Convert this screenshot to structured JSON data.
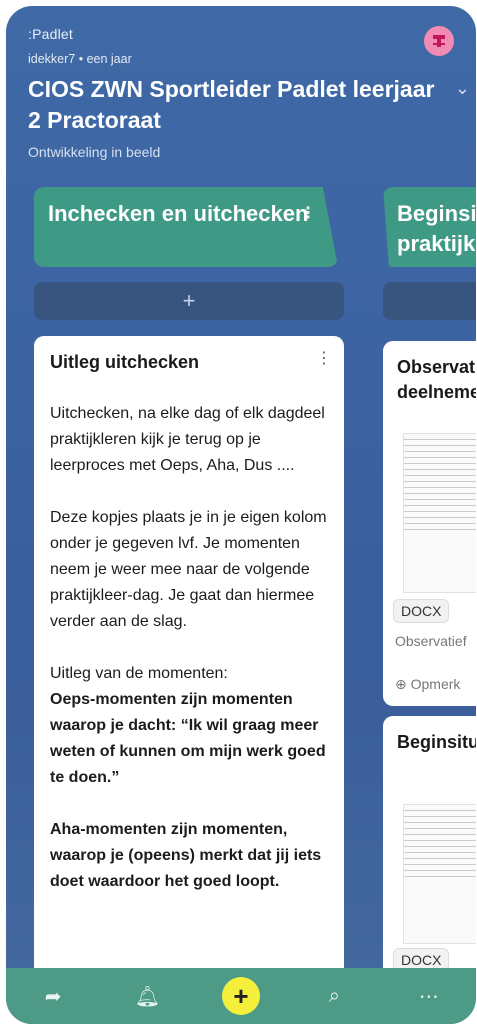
{
  "header": {
    "brand": ":Padlet",
    "meta": "idekker7 • een jaar",
    "title": "CIOS ZWN Sportleider Padlet leerjaar 2 Practoraat",
    "subtitle": "Ontwikkeling in beeld"
  },
  "columns": [
    {
      "title": "Inchecken en uitchecken"
    },
    {
      "title": "Beginsituatie praktijk"
    }
  ],
  "add_icon": "+",
  "card_main": {
    "title": "Uitleg uitchecken",
    "paragraphs": [
      "Uitchecken, na elke dag of elk dagdeel praktijkleren kijk je terug op je leerproces met Oeps, Aha, Dus ....",
      "Deze kopjes plaats je in je eigen kolom onder je gegeven lvf. Je momenten neem je weer mee naar de volgende praktijkleer-dag. Je gaat dan hiermee verder aan de slag."
    ],
    "section_intro": "Uitleg van de momenten:",
    "bold_1": "Oeps-momenten zijn momenten waarop je dacht: “Ik wil graag meer weten of kunnen om mijn werk goed te doen.”",
    "bold_2": "Aha-momenten zijn momenten, waarop je (opeens) merkt dat jij iets doet waardoor het goed loopt."
  },
  "card_obs": {
    "title": "Observatie deelnemers",
    "badge": "DOCX",
    "caption": "Observatief",
    "comment": "Opmerk"
  },
  "card_begin": {
    "title": "Beginsituatie",
    "badge": "DOCX"
  },
  "nav": {
    "share": "share-icon",
    "bell": "bell-icon",
    "add": "add-icon",
    "search": "search-icon",
    "more": "more-icon"
  }
}
